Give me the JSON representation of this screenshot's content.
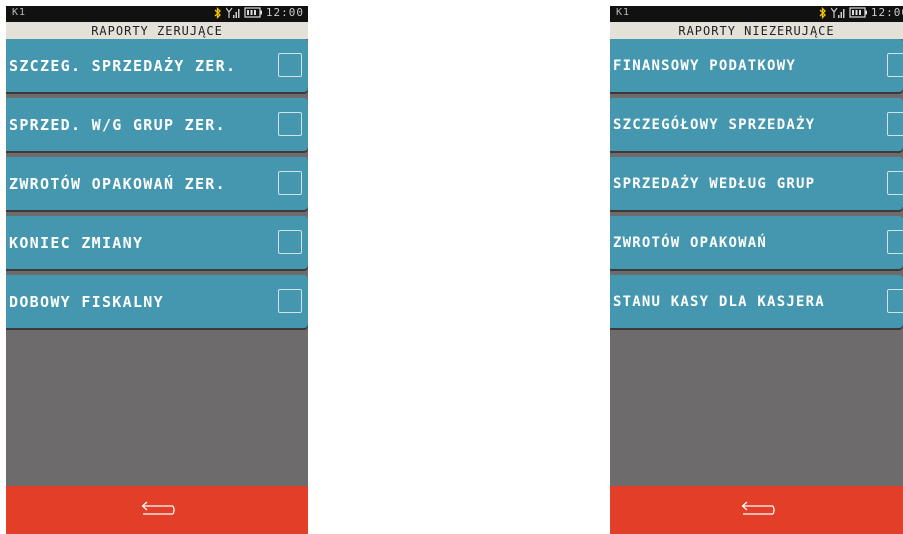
{
  "left_screen": {
    "status": {
      "carrier": "K1",
      "time": "12:00"
    },
    "title": "RAPORTY ZERUJĄCE",
    "items": [
      {
        "label": "SZCZEG. SPRZEDAŻY ZER."
      },
      {
        "label": "SPRZED. W/G GRUP ZER."
      },
      {
        "label": "ZWROTÓW OPAKOWAŃ ZER."
      },
      {
        "label": "KONIEC ZMIANY"
      },
      {
        "label": "DOBOWY FISKALNY"
      }
    ],
    "footer_icon": "back-arrow-icon"
  },
  "right_screen": {
    "status": {
      "carrier": "K1",
      "time": "12:00"
    },
    "title": "RAPORTY NIEZERUJĄCE",
    "items": [
      {
        "label": "FINANSOWY PODATKOWY"
      },
      {
        "label": "SZCZEGÓŁOWY SPRZEDAŻY"
      },
      {
        "label": "SPRZEDAŻY WEDŁUG GRUP"
      },
      {
        "label": "ZWROTÓW OPAKOWAŃ"
      },
      {
        "label": "STANU KASY DLA KASJERA"
      }
    ],
    "footer_icon": "back-arrow-icon"
  },
  "colors": {
    "item_bg": "#4497ae",
    "footer_bg": "#e23e28",
    "title_bg": "#e4e1d9",
    "screen_bg": "#6e6b6c",
    "bluetooth": "#f2c400"
  }
}
